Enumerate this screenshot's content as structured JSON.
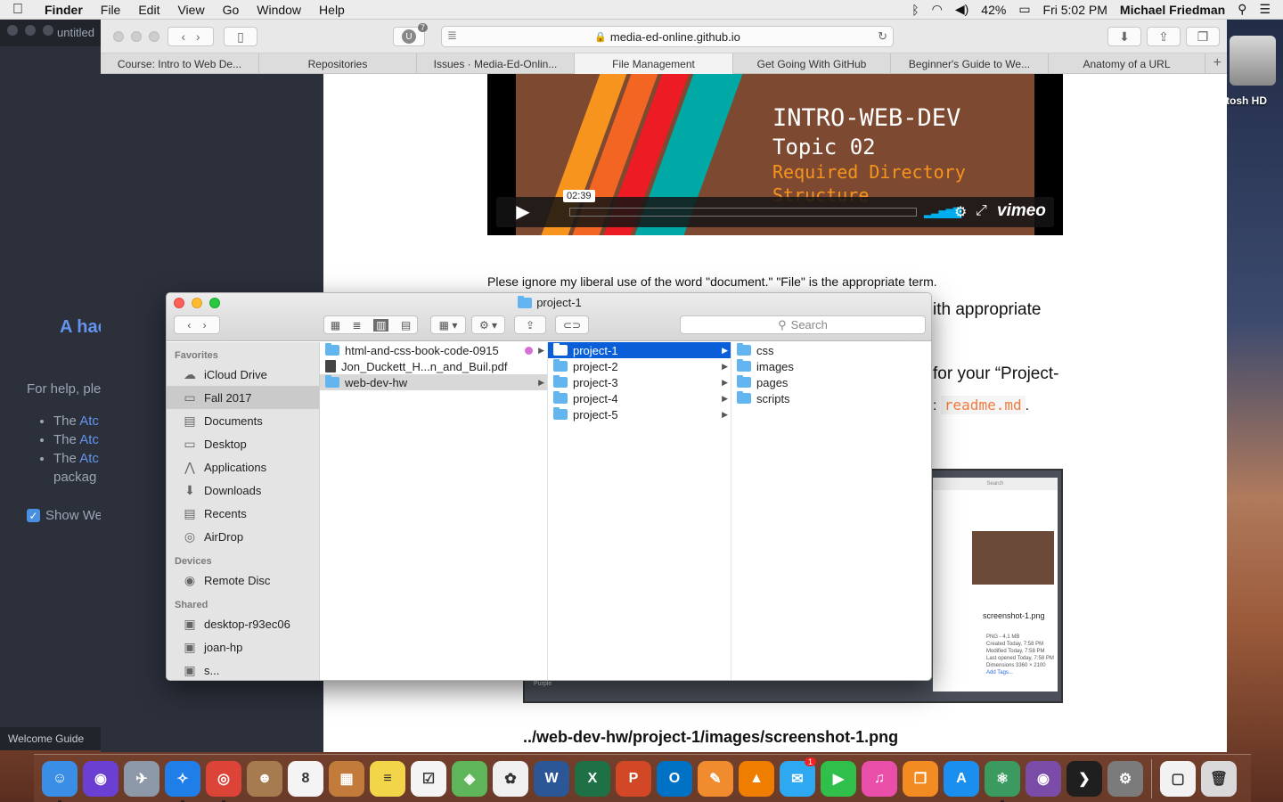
{
  "menubar": {
    "app": "Finder",
    "items": [
      "File",
      "Edit",
      "View",
      "Go",
      "Window",
      "Help"
    ],
    "battery": "42%",
    "clock": "Fri 5:02 PM",
    "user": "Michael Friedman"
  },
  "atom": {
    "tab": "untitled",
    "heading": "A hac",
    "help": "For help, ple",
    "bullets": [
      {
        "pre": "The ",
        "link": "Atc",
        "post": ""
      },
      {
        "pre": "The ",
        "link": "Atc",
        "post": ""
      },
      {
        "pre": "The ",
        "link": "Atc",
        "post": ""
      }
    ],
    "bullet_tail": "packag",
    "show_welcome": "Show We",
    "status": "Welcome Guide"
  },
  "desktop": {
    "hd_label": "tosh HD"
  },
  "safari": {
    "url": "media-ed-online.github.io",
    "ublock_badge": "7",
    "tabs": [
      {
        "label": "Course: Intro to Web De...",
        "active": false
      },
      {
        "label": "Repositories",
        "active": false
      },
      {
        "label": "Issues · Media-Ed-Onlin...",
        "active": false
      },
      {
        "label": "File Management",
        "active": true
      },
      {
        "label": "Get Going With GitHub",
        "active": false
      },
      {
        "label": "Beginner's Guide to We...",
        "active": false
      },
      {
        "label": "Anatomy of a URL",
        "active": false
      }
    ],
    "new_tab": "+"
  },
  "video": {
    "line1": "INTRO-WEB-DEV",
    "line2": "Topic 02",
    "line3": "Required Directory",
    "line4": "Structure",
    "timecode": "02:39",
    "brand": "vimeo",
    "stripe_colors": [
      "#f7941d",
      "#f26522",
      "#ed1c24",
      "#00a9a5"
    ]
  },
  "page": {
    "p1": "Plese ignore my liberal use of the word \"document.\" \"File\" is the appropriate term.",
    "p2": "ith appropriate",
    "p3": "for your “Project-",
    "p4_pre": ":",
    "p4_code": "readme.md",
    "p4_post": ".",
    "path": "../web-dev-hw/project-1/images/screenshot-1.png",
    "shot": {
      "search": "Search",
      "filename": "screenshot-1.png",
      "meta": [
        "PNG - 4.1 MB",
        "Created  Today, 7:58 PM",
        "Modified  Today, 7:58 PM",
        "Last opened  Today, 7:58 PM",
        "Dimensions  3360 × 2100",
        "Add Tags..."
      ],
      "tag": "Purple"
    }
  },
  "finder": {
    "title": "project-1",
    "search_placeholder": "Search",
    "favorites_header": "Favorites",
    "favorites": [
      {
        "label": "iCloud Drive",
        "icon": "cloud-icon",
        "glyph": "☁",
        "selected": false
      },
      {
        "label": "Fall 2017",
        "icon": "folder-icon",
        "glyph": "▭",
        "selected": true
      },
      {
        "label": "Documents",
        "icon": "documents-icon",
        "glyph": "▤",
        "selected": false
      },
      {
        "label": "Desktop",
        "icon": "desktop-icon",
        "glyph": "▭",
        "selected": false
      },
      {
        "label": "Applications",
        "icon": "applications-icon",
        "glyph": "⋀",
        "selected": false
      },
      {
        "label": "Downloads",
        "icon": "downloads-icon",
        "glyph": "⬇",
        "selected": false
      },
      {
        "label": "Recents",
        "icon": "recents-icon",
        "glyph": "▤",
        "selected": false
      },
      {
        "label": "AirDrop",
        "icon": "airdrop-icon",
        "glyph": "◎",
        "selected": false
      }
    ],
    "devices_header": "Devices",
    "devices": [
      {
        "label": "Remote Disc",
        "icon": "disc-icon",
        "glyph": "◉"
      }
    ],
    "shared_header": "Shared",
    "shared": [
      {
        "label": "desktop-r93ec06",
        "icon": "computer-icon",
        "glyph": "▣"
      },
      {
        "label": "joan-hp",
        "icon": "computer-icon",
        "glyph": "▣"
      },
      {
        "label": "s...",
        "icon": "computer-icon",
        "glyph": "▣"
      }
    ],
    "col1": [
      {
        "label": "html-and-css-book-code-0915",
        "type": "folder",
        "state": "",
        "tag": "purple"
      },
      {
        "label": "Jon_Duckett_H...n_and_Buil.pdf",
        "type": "pdf",
        "state": "",
        "tag": ""
      },
      {
        "label": "web-dev-hw",
        "type": "folder",
        "state": "gray",
        "tag": ""
      }
    ],
    "col2": [
      {
        "label": "project-1",
        "state": "sel"
      },
      {
        "label": "project-2",
        "state": ""
      },
      {
        "label": "project-3",
        "state": ""
      },
      {
        "label": "project-4",
        "state": ""
      },
      {
        "label": "project-5",
        "state": ""
      }
    ],
    "col3": [
      {
        "label": "css"
      },
      {
        "label": "images"
      },
      {
        "label": "pages"
      },
      {
        "label": "scripts"
      }
    ]
  },
  "dock": {
    "apps": [
      {
        "name": "finder",
        "color": "#3a8ee6",
        "glyph": "☺",
        "running": true,
        "badge": ""
      },
      {
        "name": "siri",
        "color": "#6a3fd1",
        "glyph": "◉",
        "running": false,
        "badge": ""
      },
      {
        "name": "launchpad",
        "color": "#8d98a8",
        "glyph": "✈",
        "running": false,
        "badge": ""
      },
      {
        "name": "safari",
        "color": "#1f7ee8",
        "glyph": "✧",
        "running": true,
        "badge": ""
      },
      {
        "name": "chrome",
        "color": "#dc4437",
        "glyph": "◎",
        "running": true,
        "badge": ""
      },
      {
        "name": "contacts",
        "color": "#a67b4f",
        "glyph": "☻",
        "running": false,
        "badge": ""
      },
      {
        "name": "calendar",
        "color": "#f4f4f4",
        "glyph": "8",
        "running": false,
        "badge": ""
      },
      {
        "name": "calculator",
        "color": "#c27b3a",
        "glyph": "▦",
        "running": false,
        "badge": ""
      },
      {
        "name": "notes",
        "color": "#f3d54a",
        "glyph": "≡",
        "running": false,
        "badge": ""
      },
      {
        "name": "reminders",
        "color": "#f4f4f4",
        "glyph": "☑",
        "running": false,
        "badge": ""
      },
      {
        "name": "maps",
        "color": "#5fb65a",
        "glyph": "◈",
        "running": false,
        "badge": ""
      },
      {
        "name": "photos",
        "color": "#f0f0f0",
        "glyph": "✿",
        "running": false,
        "badge": ""
      },
      {
        "name": "word",
        "color": "#2b5797",
        "glyph": "W",
        "running": false,
        "badge": ""
      },
      {
        "name": "excel",
        "color": "#1e7145",
        "glyph": "X",
        "running": false,
        "badge": ""
      },
      {
        "name": "powerpoint",
        "color": "#d24726",
        "glyph": "P",
        "running": false,
        "badge": ""
      },
      {
        "name": "outlook",
        "color": "#0072c6",
        "glyph": "O",
        "running": false,
        "badge": ""
      },
      {
        "name": "ibooks-author",
        "color": "#f08c2e",
        "glyph": "✎",
        "running": false,
        "badge": ""
      },
      {
        "name": "vlc",
        "color": "#ee7d00",
        "glyph": "▲",
        "running": false,
        "badge": ""
      },
      {
        "name": "messages",
        "color": "#2fa8f2",
        "glyph": "✉",
        "running": false,
        "badge": "1"
      },
      {
        "name": "facetime",
        "color": "#2fbf4a",
        "glyph": "▶",
        "running": false,
        "badge": ""
      },
      {
        "name": "itunes",
        "color": "#e94fa8",
        "glyph": "♫",
        "running": false,
        "badge": ""
      },
      {
        "name": "ibooks",
        "color": "#f28b22",
        "glyph": "❐",
        "running": false,
        "badge": ""
      },
      {
        "name": "app-store",
        "color": "#1a8ff0",
        "glyph": "A",
        "running": false,
        "badge": ""
      },
      {
        "name": "atom",
        "color": "#3b9a5f",
        "glyph": "⚛",
        "running": true,
        "badge": ""
      },
      {
        "name": "github-desktop",
        "color": "#7b4ba8",
        "glyph": "◉",
        "running": false,
        "badge": ""
      },
      {
        "name": "plex",
        "color": "#1f1f1f",
        "glyph": "❯",
        "running": false,
        "badge": ""
      },
      {
        "name": "system-preferences",
        "color": "#7b7b7b",
        "glyph": "⚙",
        "running": false,
        "badge": ""
      }
    ],
    "trailing": [
      {
        "name": "pdf-document",
        "color": "#f2f2f2",
        "glyph": "▢"
      },
      {
        "name": "trash",
        "color": "#d9d9d9",
        "glyph": "🗑"
      }
    ]
  }
}
